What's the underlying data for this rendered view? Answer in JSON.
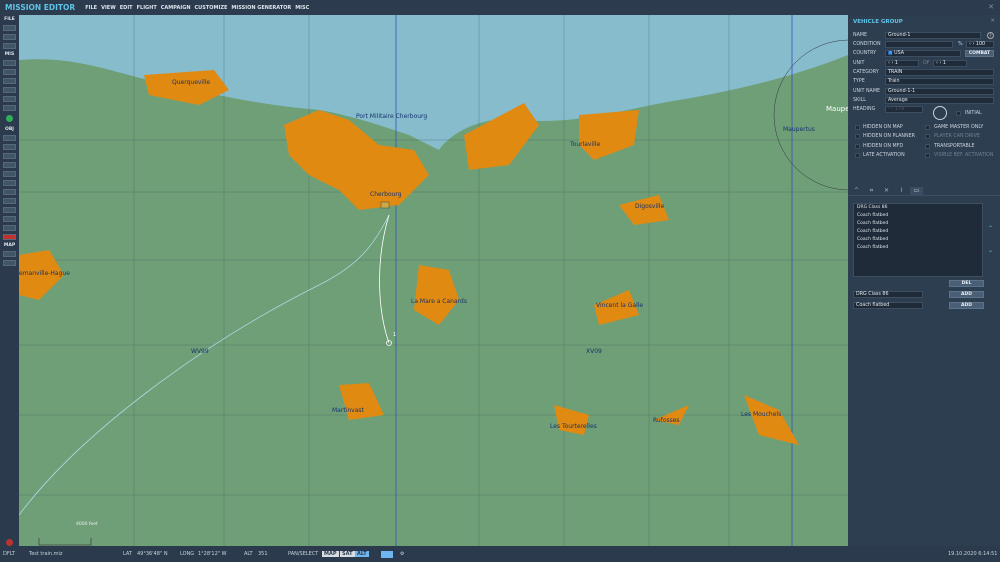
{
  "app": {
    "title": "MISSION EDITOR",
    "menu": [
      "FILE",
      "VIEW",
      "EDIT",
      "FLIGHT",
      "CAMPAIGN",
      "CUSTOMIZE",
      "MISSION GENERATOR",
      "MISC"
    ]
  },
  "toolbar": {
    "sections": {
      "file": "FILE",
      "mis": "MIS",
      "obj": "OBJ",
      "map": "MAP"
    }
  },
  "map": {
    "labels": [
      "Querqueville",
      "Port Militaire Cherbourg",
      "Cherbourg",
      "Tourlaville",
      "Digosville",
      "emanville-Hague",
      "La Mare a Canards",
      "Vincent la Galle",
      "WV99",
      "XV09",
      "Martinvast",
      "Les Tourterelles",
      "Rufosses",
      "Les Mouchels",
      "Maupertus",
      "Maupe"
    ],
    "scale": "4000 feet",
    "waypoint": "1"
  },
  "panel": {
    "title": "VEHICLE GROUP",
    "name_label": "NAME",
    "name": "Ground-1",
    "condition_label": "CONDITION",
    "condition_unit": "%",
    "condition": "100",
    "country_label": "COUNTRY",
    "country": "USA",
    "combat": "COMBAT",
    "unit_label": "UNIT",
    "unit": "1",
    "of": "OF",
    "unit_total": "1",
    "category_label": "CATEGORY",
    "category": "TRAIN",
    "type_label": "TYPE",
    "type": "Train",
    "unitname_label": "UNIT NAME",
    "unit_name": "Ground-1-1",
    "skill_label": "SKILL",
    "skill": "Average",
    "heading_label": "HEADING",
    "heading": "179",
    "initial": "INITIAL",
    "checks": [
      "HIDDEN ON MAP",
      "GAME MASTER ONLY",
      "HIDDEN ON PLANNER",
      "PLAYER CAN DRIVE",
      "HIDDEN ON MFD",
      "TRANSPORTABLE",
      "LATE ACTIVATION",
      "VISIBLE BEF. ACTIVATION"
    ],
    "wagons": [
      "DRG Class 86",
      "Coach flatbed",
      "Coach flatbed",
      "Coach flatbed",
      "Coach flatbed",
      "Coach flatbed"
    ],
    "del": "DEL",
    "add": "ADD",
    "select1": "DRG Class 86",
    "select2": "Coach flatbed"
  },
  "status": {
    "profile": "DFLT",
    "file": "Test train.miz",
    "lat_label": "LAT",
    "lat": "49°36'48\" N",
    "long_label": "LONG",
    "long": "1°28'12\" W",
    "alt_label": "ALT",
    "alt": "351",
    "pan": "PAN/SELECT",
    "map": "MAP",
    "sat": "SAT",
    "alt_btn": "ALT",
    "datetime": "19.10.2020 6:14:51"
  }
}
